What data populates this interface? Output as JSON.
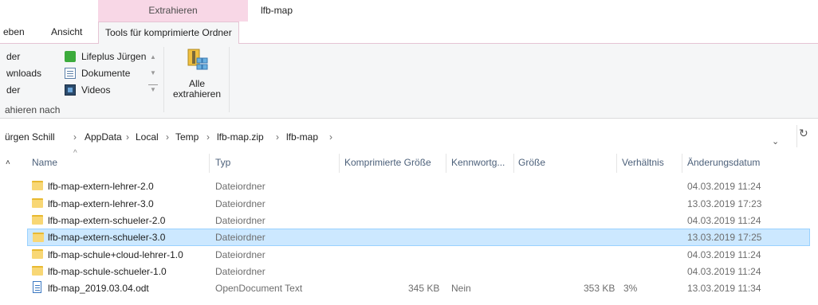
{
  "context_tab": {
    "label": "Extrahieren"
  },
  "window": {
    "title": "lfb-map"
  },
  "tabs": [
    {
      "label": "eben"
    },
    {
      "label": "Ansicht"
    },
    {
      "label": "Tools für komprimierte Ordner"
    }
  ],
  "ribbon": {
    "left_items": [
      "der",
      "wnloads",
      "der"
    ],
    "right_items": [
      {
        "label": "Lifeplus Jürgen",
        "icon": "lifeplus-folder-icon"
      },
      {
        "label": "Dokumente",
        "icon": "documents-icon"
      },
      {
        "label": "Videos",
        "icon": "videos-icon"
      }
    ],
    "group_label": "ahieren nach",
    "extract_all_line1": "Alle",
    "extract_all_line2": "extrahieren"
  },
  "address": {
    "crumbs": [
      "ürgen Schill",
      "AppData",
      "Local",
      "Temp",
      "lfb-map.zip",
      "lfb-map"
    ],
    "separator": "›",
    "dropdown": "⌄",
    "refresh": "↻"
  },
  "columns": {
    "name": "Name",
    "type": "Typ",
    "compressed": "Komprimierte Größe",
    "password": "Kennwortg...",
    "size": "Größe",
    "ratio": "Verhältnis",
    "date": "Änderungsdatum"
  },
  "files": [
    {
      "name": "lfb-map-extern-lehrer-2.0",
      "type": "Dateiordner",
      "compressed": "",
      "password": "",
      "size": "",
      "ratio": "",
      "date": "04.03.2019 11:24",
      "kind": "folder",
      "selected": false
    },
    {
      "name": "lfb-map-extern-lehrer-3.0",
      "type": "Dateiordner",
      "compressed": "",
      "password": "",
      "size": "",
      "ratio": "",
      "date": "13.03.2019 17:23",
      "kind": "folder",
      "selected": false
    },
    {
      "name": "lfb-map-extern-schueler-2.0",
      "type": "Dateiordner",
      "compressed": "",
      "password": "",
      "size": "",
      "ratio": "",
      "date": "04.03.2019 11:24",
      "kind": "folder",
      "selected": false
    },
    {
      "name": "lfb-map-extern-schueler-3.0",
      "type": "Dateiordner",
      "compressed": "",
      "password": "",
      "size": "",
      "ratio": "",
      "date": "13.03.2019 17:25",
      "kind": "folder",
      "selected": true
    },
    {
      "name": "lfb-map-schule+cloud-lehrer-1.0",
      "type": "Dateiordner",
      "compressed": "",
      "password": "",
      "size": "",
      "ratio": "",
      "date": "04.03.2019 11:24",
      "kind": "folder",
      "selected": false
    },
    {
      "name": "lfb-map-schule-schueler-1.0",
      "type": "Dateiordner",
      "compressed": "",
      "password": "",
      "size": "",
      "ratio": "",
      "date": "04.03.2019 11:24",
      "kind": "folder",
      "selected": false
    },
    {
      "name": "lfb-map_2019.03.04.odt",
      "type": "OpenDocument Text",
      "compressed": "345 KB",
      "password": "Nein",
      "size": "353 KB",
      "ratio": "3%",
      "date": "13.03.2019 11:34",
      "kind": "odt",
      "selected": false
    }
  ],
  "colors": {
    "context_accent": "#f8d7e6",
    "selection": "#cce8ff",
    "folder": "#f8d775"
  }
}
